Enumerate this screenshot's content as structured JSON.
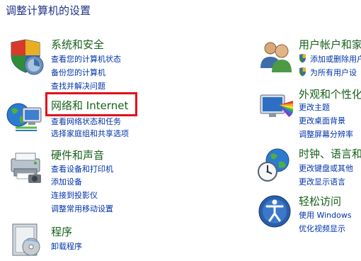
{
  "page": {
    "title": "调整计算机的设置"
  },
  "categories": [
    {
      "title": "系统和安全",
      "links": [
        "查看您的计算机状态",
        "备份您的计算机",
        "查找并解决问题"
      ]
    },
    {
      "title": "网络和 Internet",
      "links": [
        "查看网络状态和任务",
        "选择家庭组和共享选项"
      ]
    },
    {
      "title": "硬件和声音",
      "links": [
        "查看设备和打印机",
        "添加设备",
        "连接到投影仪",
        "调整常用移动设置"
      ]
    },
    {
      "title": "程序",
      "links": [
        "卸载程序"
      ]
    },
    {
      "title": "用户帐户和家",
      "links": [
        "添加或删除用户",
        "为所有用户设"
      ]
    },
    {
      "title": "外观和个性化",
      "links": [
        "更改主题",
        "更改桌面背景",
        "调整屏幕分辨率"
      ]
    },
    {
      "title": "时钟、语言和",
      "links": [
        "更改键盘或其他",
        "更改显示语言"
      ]
    },
    {
      "title": "轻松访问",
      "links": [
        "使用 Windows",
        "优化视频显示"
      ]
    }
  ],
  "colors": {
    "category_title": "#17611b",
    "link": "#0033aa",
    "page_title": "#1e3287",
    "highlight": "#e0101b"
  }
}
